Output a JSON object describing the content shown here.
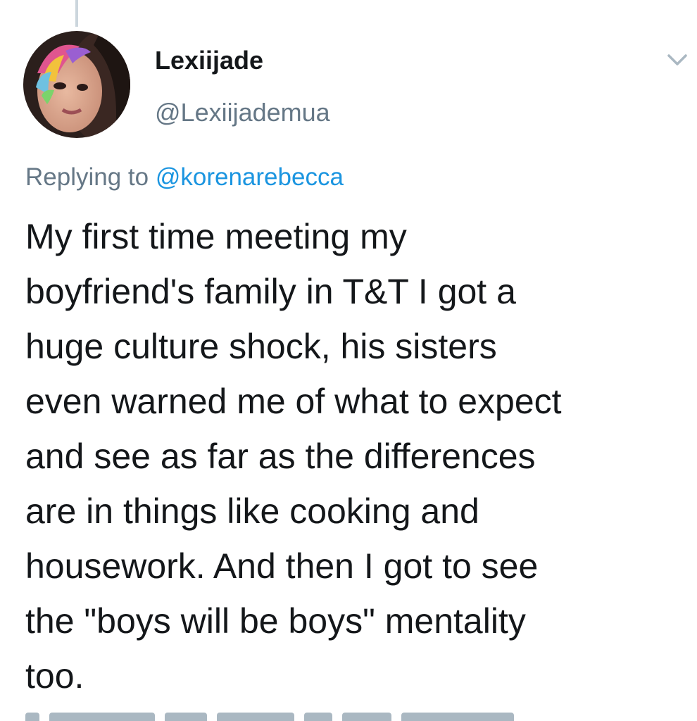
{
  "tweet": {
    "author": {
      "display_name": "Lexiijade",
      "handle": "@Lexiijademua",
      "avatar": "profile-photo"
    },
    "more_icon": "chevron-down-icon",
    "reply_prefix": "Replying to",
    "reply_mention": "@korenarebecca",
    "text_lines": [
      "My first time meeting my",
      "boyfriend's family in T&T I got a",
      "huge culture shock, his sisters",
      "even warned me of what to expect",
      "and see as far as the differences",
      "are in things like cooking and",
      "housework. And then I got to see",
      "the \"boys will be boys\" mentality",
      "too."
    ]
  },
  "colors": {
    "text": "#14171a",
    "secondary": "#657786",
    "link": "#1b95e0",
    "thread_line": "#ccd6dd"
  }
}
